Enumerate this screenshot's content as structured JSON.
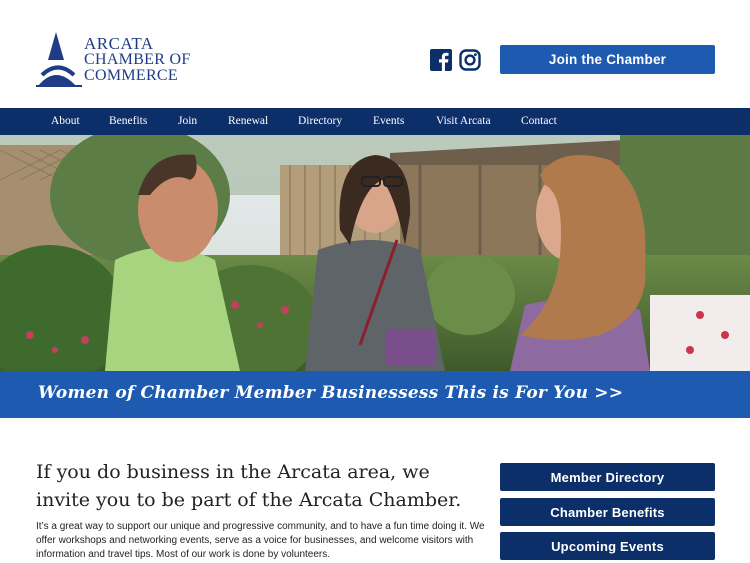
{
  "header": {
    "logo": {
      "line1": "ARCATA",
      "line2": "CHAMBER OF",
      "line3": "COMMERCE"
    },
    "social": [
      {
        "icon": "facebook-icon"
      },
      {
        "icon": "instagram-icon"
      }
    ],
    "join_label": "Join the Chamber"
  },
  "nav": {
    "items": [
      {
        "label": "About"
      },
      {
        "label": "Benefits"
      },
      {
        "label": "Join"
      },
      {
        "label": "Renewal"
      },
      {
        "label": "Directory"
      },
      {
        "label": "Events"
      },
      {
        "label": "Visit Arcata"
      },
      {
        "label": "Contact"
      }
    ]
  },
  "banner": {
    "text": "Women of Chamber Member Businessess This is For You  >>"
  },
  "main": {
    "headline": "If you do business in the Arcata area, we invite you to be part of the Arcata Chamber.",
    "body": "It’s a great way to support our unique and progressive community, and to have a fun time doing it. We offer workshops and networking events, serve as a voice for businesses, and welcome visitors with information and travel tips. Most of our work is done by volunteers."
  },
  "sidebar": {
    "buttons": [
      {
        "label": "Member Directory"
      },
      {
        "label": "Chamber Benefits"
      },
      {
        "label": "Upcoming Events"
      }
    ]
  },
  "colors": {
    "primary_blue": "#1e5bb0",
    "navy": "#0c2f6a",
    "logo_blue": "#1f3c88"
  }
}
